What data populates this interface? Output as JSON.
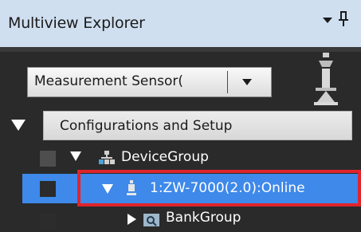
{
  "panel": {
    "title": "Multiview Explorer"
  },
  "selector": {
    "value": "Measurement Sensor("
  },
  "tree": {
    "root_label": "Configurations and Setup",
    "items": [
      {
        "label": "DeviceGroup"
      },
      {
        "label": "1:ZW-7000(2.0):Online"
      },
      {
        "label": "BankGroup"
      }
    ]
  },
  "colors": {
    "title_bg": "#cfdff0",
    "panel_bg": "#2a2a2a",
    "selection": "#3e89ea",
    "highlight_border": "#e0242c"
  }
}
